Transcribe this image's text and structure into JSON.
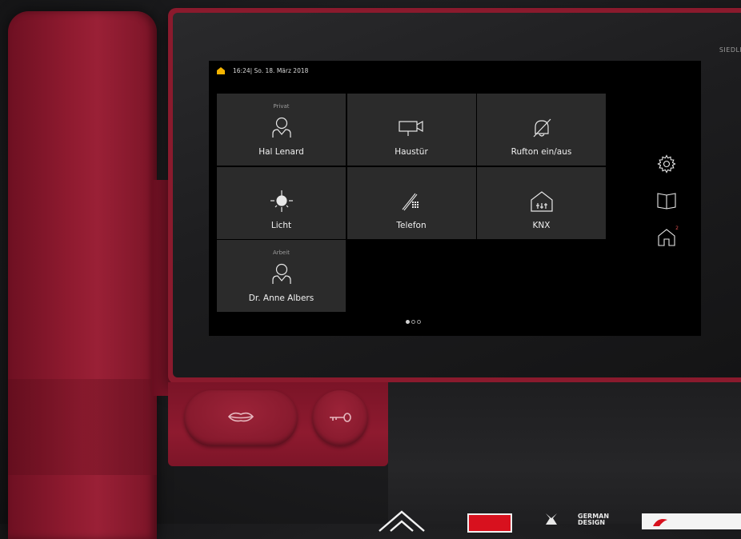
{
  "device": {
    "brand_label": "SIEDLE"
  },
  "statusbar": {
    "time_date": "16:24| So. 18. März 2018",
    "home_indicator_color": "#f5b400"
  },
  "tiles": [
    {
      "category": "Privat",
      "label": "Hal Lenard",
      "icon": "person-icon"
    },
    {
      "category": "",
      "label": "Haustür",
      "icon": "camera-icon"
    },
    {
      "category": "",
      "label": "Rufton ein/aus",
      "icon": "bell-off-icon"
    },
    {
      "category": "",
      "label": "Licht",
      "icon": "light-icon"
    },
    {
      "category": "",
      "label": "Telefon",
      "icon": "phone-keypad-icon"
    },
    {
      "category": "",
      "label": "KNX",
      "icon": "house-knx-icon"
    },
    {
      "category": "Arbeit",
      "label": "Dr. Anne Albers",
      "icon": "person-icon"
    }
  ],
  "pager": {
    "pages": 3,
    "current": 1
  },
  "sidebar": {
    "settings_icon": "gear-icon",
    "book_icon": "book-icon",
    "home_icon": "home-icon",
    "home_badge": "2"
  },
  "hardware_buttons": {
    "speak_icon": "lips-icon",
    "door_icon": "key-icon"
  },
  "awards": {
    "german_design": "GERMAN\nDESIGN"
  },
  "colors": {
    "accent_red": "#8e1a2f",
    "tile_bg": "#2b2b2b",
    "badge": "#e05050"
  }
}
